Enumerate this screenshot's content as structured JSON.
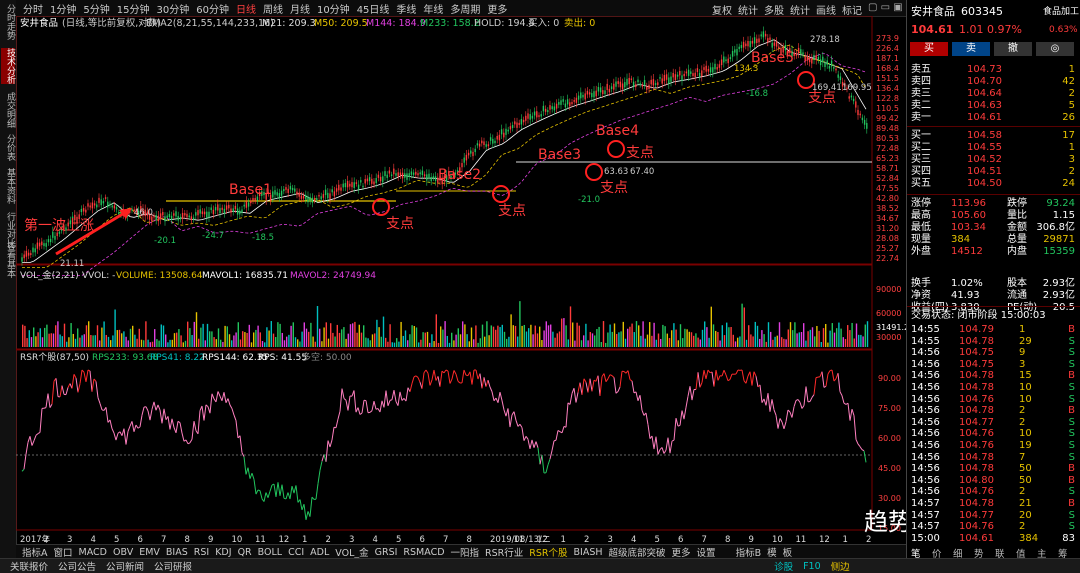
{
  "left_rail": [
    "分时走势",
    "技术分析",
    "成交明细",
    "分价表",
    "基本资料",
    "行业对比",
    "查看基本"
  ],
  "top_toolbar": {
    "periods": [
      "分时",
      "1分钟",
      "5分钟",
      "15分钟",
      "30分钟",
      "60分钟",
      "日线",
      "周线",
      "月线",
      "10分钟",
      "45日线",
      "季线",
      "年线",
      "多周期",
      "更多"
    ],
    "active_period": "日线",
    "right_buttons": [
      "复权",
      "统计",
      "多股",
      "统计",
      "画线",
      "标记"
    ]
  },
  "main_legend": {
    "name": "安井食品",
    "mode": "(日线,等比前复权,对数)",
    "ema_label": "EMA2(8,21,55,144,233,16)",
    "m21": "M21: 209.3",
    "m50": "M50: 209.5",
    "m144": "M144: 184.9",
    "m233": "M233: 158.2",
    "hold": "HOLD: 194.8",
    "buy": "买入: 0",
    "sell": "卖出: 0"
  },
  "main_axis": [
    "273.9",
    "226.4",
    "187.1",
    "168.4",
    "151.5",
    "136.4",
    "122.8",
    "110.5",
    "99.42",
    "89.48",
    "80.53",
    "72.48",
    "65.23",
    "58.71",
    "52.84",
    "47.55",
    "42.80",
    "38.52",
    "34.67",
    "31.20",
    "28.08",
    "25.27",
    "22.74"
  ],
  "annotations": {
    "wave1": "第一波上涨",
    "bases": [
      "Base1",
      "Base2",
      "Base3",
      "Base4",
      "Base5"
    ],
    "support": "支点",
    "price_labels": [
      "21.11",
      "46.0",
      "-20.1",
      "-24.7",
      "-18.5",
      "-21.0",
      "63.63",
      "67.40",
      "-16.8",
      "169.41",
      "169.95",
      "278.18",
      "134.3"
    ]
  },
  "vol_legend": {
    "title": "VOL_金(2,21)",
    "vvol": "VVOL: -",
    "volume": "VOLUME: 13508.64",
    "mavol1": "MAVOL1: 16835.71",
    "mavol2": "MAVOL2: 24749.94"
  },
  "vol_axis": [
    "90000",
    "60000",
    "30000",
    "31491.24"
  ],
  "rsr_legend": {
    "title": "RSR个股(87,50)",
    "rps233": "RPS233: 93.68",
    "rps41": "RPS41: 8.22",
    "rps144": "RPS144: 62.35",
    "rps": "RPS: 41.55",
    "duokong": "多空: 50.00"
  },
  "rsr_axis": [
    "90.00",
    "75.00",
    "60.00",
    "45.00",
    "30.00",
    "15.00"
  ],
  "x_axis": {
    "labels": [
      "2017年",
      "2",
      "3",
      "4",
      "5",
      "6",
      "7",
      "8",
      "9",
      "10",
      "11",
      "12",
      "1",
      "2",
      "3",
      "4",
      "5",
      "6",
      "7",
      "8",
      "2019/08/13/二",
      "11",
      "12",
      "1",
      "2",
      "3",
      "4",
      "5",
      "6",
      "7",
      "8",
      "9",
      "10",
      "11",
      "12",
      "1",
      "2"
    ]
  },
  "bottom_tabs": [
    "指标A",
    "窗口",
    "MACD",
    "OBV",
    "EMV",
    "BIAS",
    "RSI",
    "KDJ",
    "QR",
    "BOLL",
    "CCI",
    "ADL",
    "VOL_金",
    "GRSI",
    "RSMACD",
    "一阳指",
    "RSR行业",
    "RSR个股",
    "BIASH",
    "超级底部突破",
    "更多",
    "设置"
  ],
  "bottom_tabs_active": "RSR个股",
  "bottom_right": [
    "指标B",
    "模",
    "板"
  ],
  "status_bar": [
    "关联报价",
    "公司公告",
    "公司新闻",
    "公司研报"
  ],
  "status_right": [
    "诊股",
    "F10",
    "侧边"
  ],
  "right_panel": {
    "stock_name": "安井食品",
    "code": "603345",
    "sector": "食品加工",
    "price": "104.61",
    "change": "1.01",
    "pct": "0.97%",
    "sector_pct": "0.63%",
    "buttons": [
      "买",
      "卖",
      "撤",
      "◎"
    ],
    "asks": [
      {
        "label": "卖五",
        "price": "104.73",
        "vol": "1"
      },
      {
        "label": "卖四",
        "price": "104.70",
        "vol": "42"
      },
      {
        "label": "卖三",
        "price": "104.64",
        "vol": "2"
      },
      {
        "label": "卖二",
        "price": "104.63",
        "vol": "5"
      },
      {
        "label": "卖一",
        "price": "104.61",
        "vol": "26"
      }
    ],
    "bids": [
      {
        "label": "买一",
        "price": "104.58",
        "vol": "17"
      },
      {
        "label": "买二",
        "price": "104.55",
        "vol": "1"
      },
      {
        "label": "买三",
        "price": "104.52",
        "vol": "3"
      },
      {
        "label": "买四",
        "price": "104.51",
        "vol": "2"
      },
      {
        "label": "买五",
        "price": "104.50",
        "vol": "24"
      }
    ],
    "stats": [
      [
        "涨停",
        "113.96",
        "跌停",
        "93.24"
      ],
      [
        "最高",
        "105.60",
        "量比",
        "1.15"
      ],
      [
        "最低",
        "103.34",
        "金额",
        "306.8亿"
      ],
      [
        "现量",
        "384",
        "总量",
        "29871"
      ],
      [
        "外盘",
        "14512",
        "内盘",
        "15359"
      ],
      [
        "换手",
        "1.02%",
        "股本",
        "2.93亿"
      ],
      [
        "净资",
        "41.93",
        "流通",
        "2.93亿"
      ],
      [
        "收益(四)",
        "3.830",
        "PE(动)",
        "20.5"
      ]
    ],
    "trade_status": "交易状态: 闭市阶段 15:00:03",
    "ticks": [
      [
        "14:55",
        "104.79",
        "1",
        "B"
      ],
      [
        "14:55",
        "104.78",
        "29",
        "S"
      ],
      [
        "14:56",
        "104.75",
        "9",
        "S"
      ],
      [
        "14:56",
        "104.75",
        "3",
        "S"
      ],
      [
        "14:56",
        "104.78",
        "15",
        "B"
      ],
      [
        "14:56",
        "104.78",
        "10",
        "S"
      ],
      [
        "14:56",
        "104.76",
        "10",
        "S"
      ],
      [
        "14:56",
        "104.78",
        "2",
        "B"
      ],
      [
        "14:56",
        "104.77",
        "2",
        "S"
      ],
      [
        "14:56",
        "104.76",
        "10",
        "S"
      ],
      [
        "14:56",
        "104.76",
        "19",
        "S"
      ],
      [
        "14:56",
        "104.78",
        "7",
        "S"
      ],
      [
        "14:56",
        "104.78",
        "50",
        "B"
      ],
      [
        "14:56",
        "104.80",
        "50",
        "B"
      ],
      [
        "14:56",
        "104.76",
        "2",
        "S"
      ],
      [
        "14:57",
        "104.78",
        "21",
        "B"
      ],
      [
        "14:57",
        "104.77",
        "20",
        "S"
      ],
      [
        "14:57",
        "104.76",
        "2",
        "S"
      ],
      [
        "15:00",
        "104.61",
        "384",
        "83"
      ]
    ],
    "tick_tabs": [
      "笔",
      "价",
      "细",
      "势",
      "联",
      "值",
      "主",
      "筹"
    ]
  },
  "watermark": "趋势一阳指",
  "chart_data": {
    "type": "line",
    "title": "安井食品 (日线,等比前复权,对数)",
    "xlabel": "",
    "ylabel": "",
    "x_range": [
      "2017-01",
      "2021-03"
    ],
    "y_log_range": [
      22.74,
      273.9
    ],
    "series": [
      {
        "name": "price",
        "values": [
          [
            "2017-01",
            22
          ],
          [
            "2017-03",
            29
          ],
          [
            "2017-05",
            40
          ],
          [
            "2017-06",
            44
          ],
          [
            "2017-07",
            37
          ],
          [
            "2017-08",
            39
          ],
          [
            "2017-09",
            36
          ],
          [
            "2017-10",
            37
          ],
          [
            "2017-11",
            36
          ],
          [
            "2017-12",
            38
          ],
          [
            "2018-01",
            40
          ],
          [
            "2018-02",
            39
          ],
          [
            "2018-03",
            45
          ],
          [
            "2018-04",
            47
          ],
          [
            "2018-05",
            49
          ],
          [
            "2018-06",
            44
          ],
          [
            "2018-07",
            46
          ],
          [
            "2018-08",
            50
          ],
          [
            "2018-09",
            52
          ],
          [
            "2018-10",
            55
          ],
          [
            "2018-11",
            60
          ],
          [
            "2018-12",
            58
          ],
          [
            "2019-01",
            58
          ],
          [
            "2019-02",
            55
          ],
          [
            "2019-03",
            63
          ],
          [
            "2019-04",
            80
          ],
          [
            "2019-05",
            86
          ],
          [
            "2019-06",
            100
          ],
          [
            "2019-07",
            110
          ],
          [
            "2019-08",
            120
          ],
          [
            "2019-09",
            130
          ],
          [
            "2019-10",
            138
          ],
          [
            "2019-11",
            147
          ],
          [
            "2019-12",
            156
          ],
          [
            "2020-01",
            168
          ],
          [
            "2020-02",
            160
          ],
          [
            "2020-03",
            172
          ],
          [
            "2020-04",
            178
          ],
          [
            "2020-05",
            185
          ],
          [
            "2020-06",
            195
          ],
          [
            "2020-07",
            220
          ],
          [
            "2020-08",
            258
          ],
          [
            "2020-09",
            278.18
          ],
          [
            "2020-10",
            240
          ],
          [
            "2020-11",
            230
          ],
          [
            "2021-01",
            200
          ],
          [
            "2021-03",
            104.61
          ]
        ]
      },
      {
        "name": "RSR",
        "values": [
          [
            "2017-01",
            45
          ],
          [
            "2017-03",
            85
          ],
          [
            "2017-05",
            90
          ],
          [
            "2017-07",
            60
          ],
          [
            "2017-09",
            75
          ],
          [
            "2017-11",
            62
          ],
          [
            "2018-01",
            85
          ],
          [
            "2018-03",
            30
          ],
          [
            "2018-05",
            35
          ],
          [
            "2018-06",
            20
          ],
          [
            "2018-08",
            80
          ],
          [
            "2018-10",
            75
          ],
          [
            "2019-01",
            90
          ],
          [
            "2019-04",
            92
          ],
          [
            "2019-07",
            60
          ],
          [
            "2019-08",
            45
          ],
          [
            "2019-10",
            85
          ],
          [
            "2020-01",
            88
          ],
          [
            "2020-03",
            50
          ],
          [
            "2020-05",
            90
          ],
          [
            "2020-08",
            92
          ],
          [
            "2020-10",
            68
          ],
          [
            "2021-01",
            95
          ],
          [
            "2021-03",
            50
          ]
        ]
      }
    ],
    "annotations": [
      "第一波上涨",
      "Base1",
      "Base2",
      "Base3",
      "Base4",
      "Base5",
      "支点"
    ],
    "rsr_ylim": [
      15,
      95
    ],
    "rsr_ref_line": 50
  }
}
